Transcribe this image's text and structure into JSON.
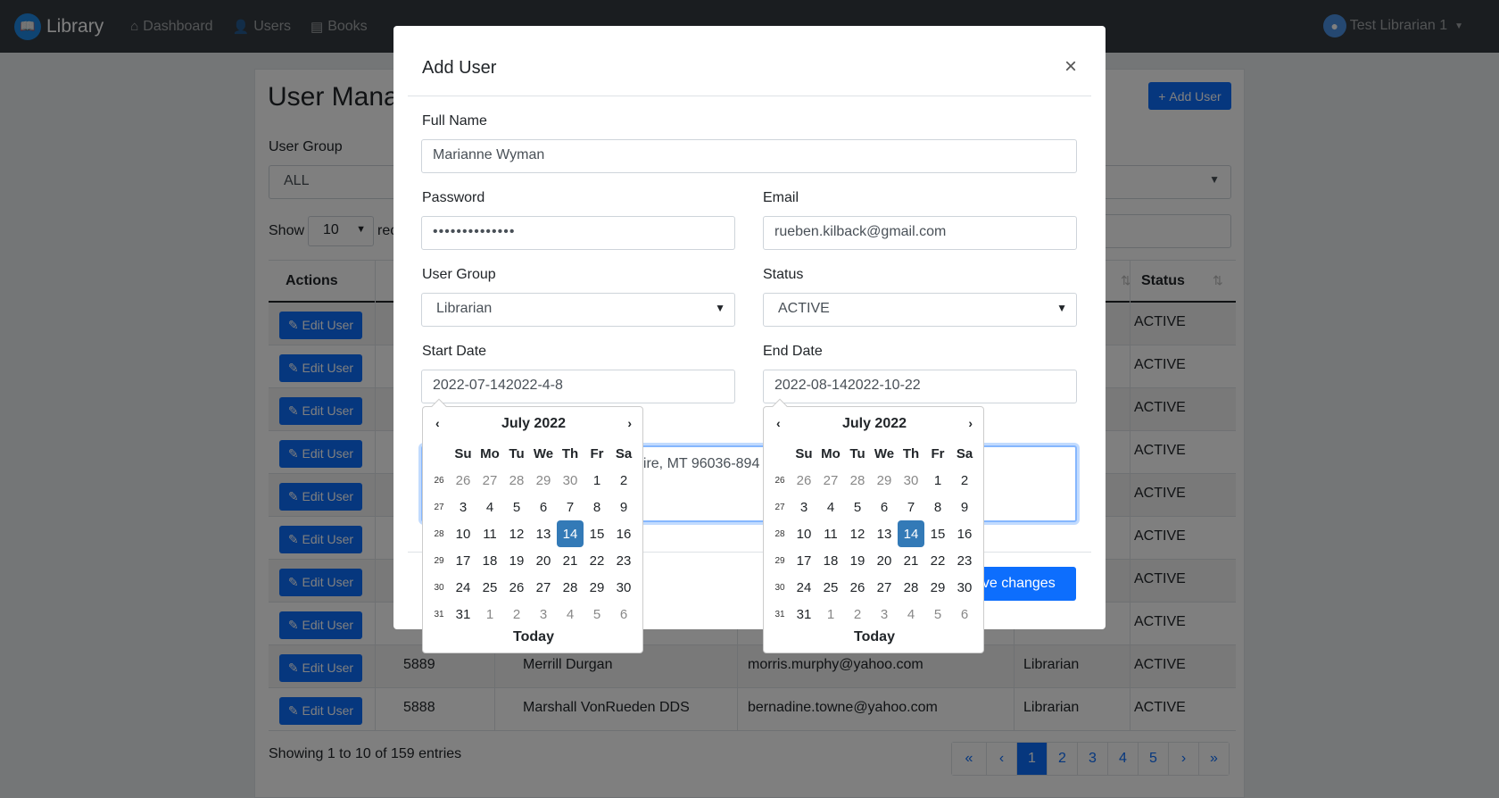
{
  "navbar": {
    "brand": "Library",
    "items": [
      {
        "label": "Dashboard",
        "icon": "home-icon"
      },
      {
        "label": "Users",
        "icon": "user-icon"
      },
      {
        "label": "Books",
        "icon": "book-icon"
      }
    ],
    "user": "Test Librarian 1"
  },
  "page": {
    "title": "User Manag",
    "add_user_label": "Add User",
    "filter_label": "User Group",
    "filter_value": "ALL",
    "show_label": "Show",
    "show_value": "10",
    "records_label": "rec",
    "headers": {
      "actions": "Actions",
      "status": "Status"
    },
    "edit_label": "Edit User",
    "rows": [
      {
        "status": "ACTIVE"
      },
      {
        "status": "ACTIVE"
      },
      {
        "status": "ACTIVE"
      },
      {
        "status": "ACTIVE"
      },
      {
        "status": "ACTIVE"
      },
      {
        "status": "ACTIVE"
      },
      {
        "status": "ACTIVE"
      },
      {
        "status": "ACTIVE"
      },
      {
        "id": "5889",
        "name": "Merrill Durgan",
        "email": "morris.murphy@yahoo.com",
        "group": "Librarian",
        "status": "ACTIVE"
      },
      {
        "id": "5888",
        "name": "Marshall VonRueden DDS",
        "email": "bernadine.towne@yahoo.com",
        "group": "Librarian",
        "status": "ACTIVE"
      }
    ],
    "info": "Showing 1 to 10 of 159 entries",
    "pages": [
      "«",
      "‹",
      "1",
      "2",
      "3",
      "4",
      "5",
      "›",
      "»"
    ],
    "active_page": "1"
  },
  "modal": {
    "title": "Add User",
    "close": "×",
    "full_name_label": "Full Name",
    "full_name_value": "Marianne Wyman",
    "password_label": "Password",
    "password_value": "••••••••••••••",
    "email_label": "Email",
    "email_value": "rueben.kilback@gmail.com",
    "user_group_label": "User Group",
    "user_group_value": "Librarian",
    "status_label": "Status",
    "status_value": "ACTIVE",
    "start_date_label": "Start Date",
    "start_date_value": "2022-07-142022-4-8",
    "end_date_label": "End Date",
    "end_date_value": "2022-08-142022-10-22",
    "address_visible": "hire, MT 96036-894",
    "save_label": "Save changes"
  },
  "datepicker": {
    "month": "July 2022",
    "dow": [
      "Su",
      "Mo",
      "Tu",
      "We",
      "Th",
      "Fr",
      "Sa"
    ],
    "weeks": [
      {
        "wk": "26",
        "days": [
          "26",
          "27",
          "28",
          "29",
          "30",
          "1",
          "2"
        ],
        "old": [
          0,
          1,
          2,
          3,
          4
        ]
      },
      {
        "wk": "27",
        "days": [
          "3",
          "4",
          "5",
          "6",
          "7",
          "8",
          "9"
        ],
        "old": []
      },
      {
        "wk": "28",
        "days": [
          "10",
          "11",
          "12",
          "13",
          "14",
          "15",
          "16"
        ],
        "old": []
      },
      {
        "wk": "29",
        "days": [
          "17",
          "18",
          "19",
          "20",
          "21",
          "22",
          "23"
        ],
        "old": []
      },
      {
        "wk": "30",
        "days": [
          "24",
          "25",
          "26",
          "27",
          "28",
          "29",
          "30"
        ],
        "old": []
      },
      {
        "wk": "31",
        "days": [
          "31",
          "1",
          "2",
          "3",
          "4",
          "5",
          "6"
        ],
        "old": [
          1,
          2,
          3,
          4,
          5,
          6
        ]
      }
    ],
    "selected": "14",
    "today_label": "Today",
    "prev": "‹",
    "next": "›"
  }
}
